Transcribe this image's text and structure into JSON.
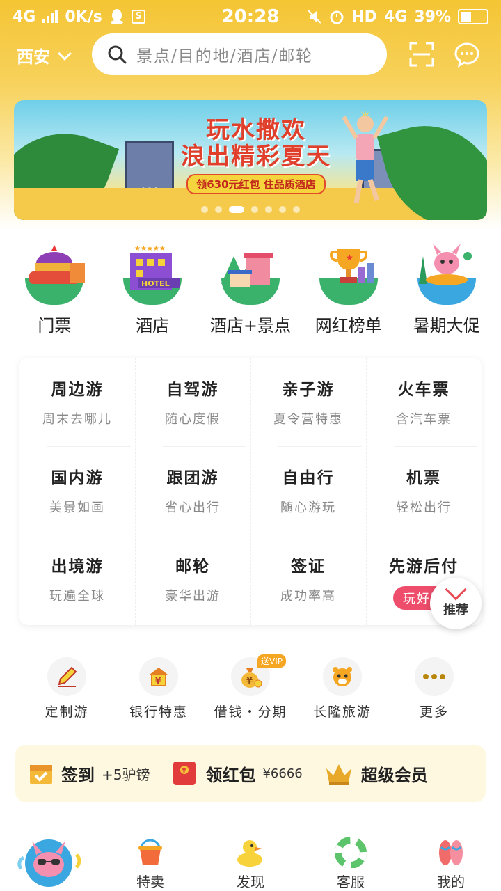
{
  "status_bar": {
    "network": "4G",
    "speed": "0K/s",
    "time": "20:28",
    "hd": "HD",
    "network2": "4G",
    "battery": "39%"
  },
  "header": {
    "city": "西安",
    "search_placeholder": "景点/目的地/酒店/邮轮"
  },
  "banner": {
    "title_line1": "玩水撒欢",
    "title_line2": "浪出精彩夏天",
    "subtitle": "领630元红包 住品质酒店",
    "hotel_sign": "W",
    "page_count": 7,
    "active_page": 2
  },
  "categories": [
    {
      "label": "门票",
      "icon": "ticket-icon"
    },
    {
      "label": "酒店",
      "icon": "hotel-icon"
    },
    {
      "label": "酒店+景点",
      "icon": "hotel-scenic-icon"
    },
    {
      "label": "网红榜单",
      "icon": "trophy-icon"
    },
    {
      "label": "暑期大促",
      "icon": "summer-sale-icon"
    }
  ],
  "grid": [
    {
      "title": "周边游",
      "sub": "周末去哪儿"
    },
    {
      "title": "自驾游",
      "sub": "随心度假"
    },
    {
      "title": "亲子游",
      "sub": "夏令营特惠"
    },
    {
      "title": "火车票",
      "sub": "含汽车票"
    },
    {
      "title": "国内游",
      "sub": "美景如画"
    },
    {
      "title": "跟团游",
      "sub": "省心出行"
    },
    {
      "title": "自由行",
      "sub": "随心游玩"
    },
    {
      "title": "机票",
      "sub": "轻松出行"
    },
    {
      "title": "出境游",
      "sub": "玩遍全球"
    },
    {
      "title": "邮轮",
      "sub": "豪华出游"
    },
    {
      "title": "签证",
      "sub": "成功率高"
    },
    {
      "title": "先游后付",
      "sub": "玩好再"
    }
  ],
  "recommend_label": "推荐",
  "services": [
    {
      "label": "定制游",
      "icon": "pencil-icon"
    },
    {
      "label": "银行特惠",
      "icon": "bank-icon"
    },
    {
      "label": "借钱・分期",
      "icon": "money-bag-icon",
      "tag": "送VIP"
    },
    {
      "label": "长隆旅游",
      "icon": "tiger-icon"
    },
    {
      "label": "更多",
      "icon": "more-icon"
    }
  ],
  "member_bar": {
    "checkin": "签到",
    "checkin_reward": "+5驴镑",
    "redpacket": "领红包",
    "redpacket_value": "¥6666",
    "super_member": "超级会员"
  },
  "bottom_nav": [
    {
      "label": "",
      "icon": "home-mascot-icon"
    },
    {
      "label": "特卖",
      "icon": "bucket-icon"
    },
    {
      "label": "发现",
      "icon": "duck-icon"
    },
    {
      "label": "客服",
      "icon": "lifebuoy-icon"
    },
    {
      "label": "我的",
      "icon": "slippers-icon"
    }
  ],
  "colors": {
    "header_yellow": "#f4c534",
    "accent_red": "#e94b55",
    "pill_pink": "#ee4d6b"
  }
}
